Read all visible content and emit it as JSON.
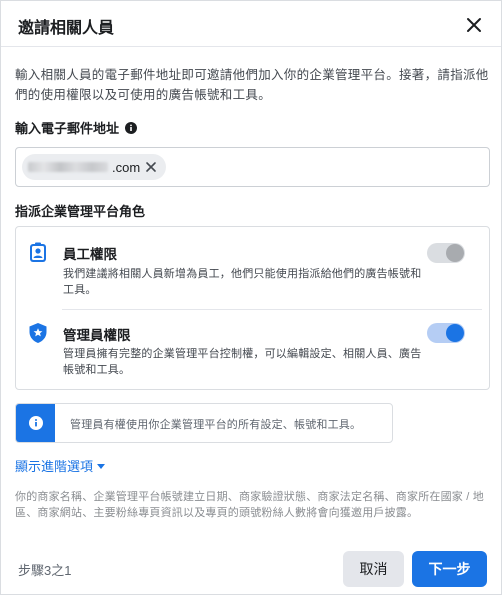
{
  "dialog": {
    "title": "邀請相關人員",
    "intro": "輸入相關人員的電子郵件地址即可邀請他們加入你的企業管理平台。接著，請指派他們的使用權限以及可使用的廣告帳號和工具。"
  },
  "email": {
    "label": "輸入電子郵件地址",
    "chip_suffix": ".com"
  },
  "roles": {
    "heading": "指派企業管理平台角色",
    "items": [
      {
        "title": "員工權限",
        "description": "我們建議將相關人員新增為員工，他們只能使用指派給他們的廣告帳號和工具。",
        "icon": "employee-badge-icon",
        "enabled": false
      },
      {
        "title": "管理員權限",
        "description": "管理員擁有完整的企業管理平台控制權，可以編輯設定、相關人員、廣告帳號和工具。",
        "icon": "admin-shield-icon",
        "enabled": true
      }
    ]
  },
  "notice": {
    "text": "管理員有權使用你企業管理平台的所有設定、帳號和工具。"
  },
  "advanced": {
    "label": "顯示進階選項"
  },
  "footnote": "你的商家名稱、企業管理平台帳號建立日期、商家驗證狀態、商家法定名稱、商家所在國家 / 地區、商家網站、主要粉絲專頁資訊以及專頁的頭號粉絲人數將會向獲邀用戶披露。",
  "footer": {
    "step": "步驟3之1",
    "cancel_label": "取消",
    "next_label": "下一步"
  },
  "colors": {
    "accent": "#1b74e4",
    "toggle_off_knob": "#a8abaf",
    "toggle_off_track": "#dadde1",
    "toggle_on_track": "#b5cdf4"
  }
}
